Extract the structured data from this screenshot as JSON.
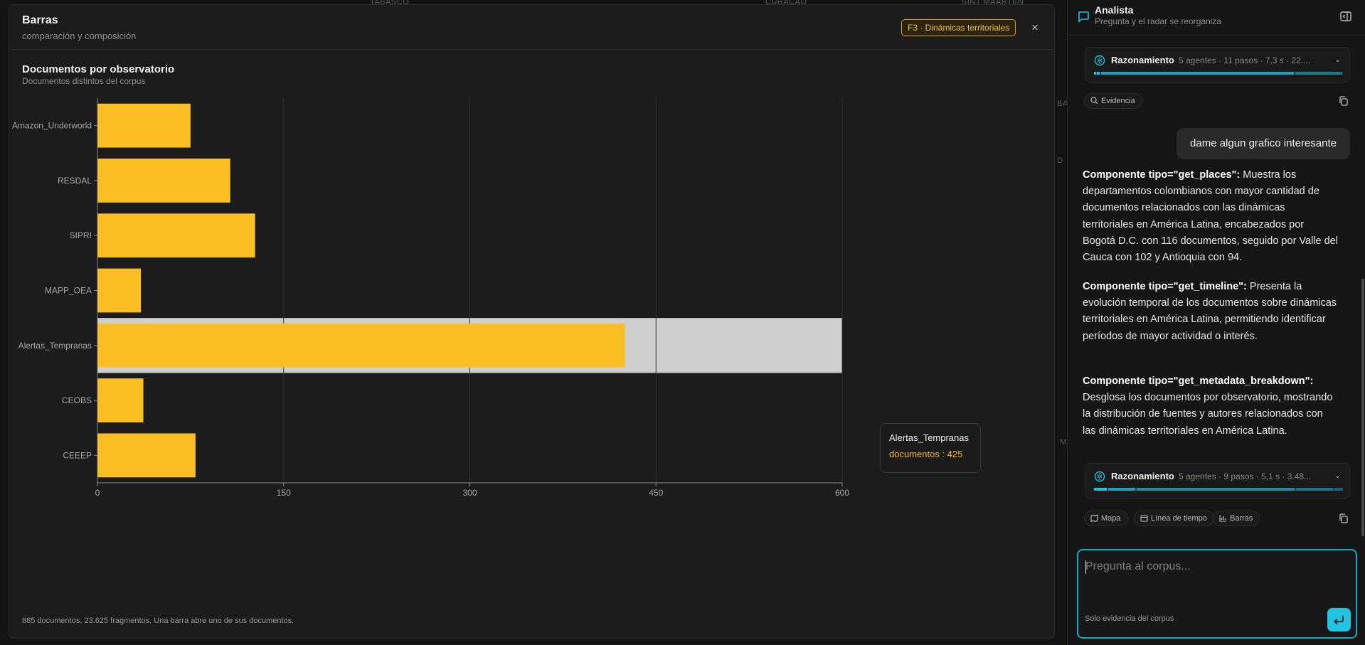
{
  "map": {
    "labels": [
      "TABASCO",
      "SINT MAARTEN",
      "CURAÇAO"
    ],
    "fragments": [
      "BA",
      "D",
      "M"
    ]
  },
  "modal": {
    "title": "Barras",
    "subtitle": "comparación y composición",
    "badge": "F3 · Dinámicas territoriales",
    "close_icon": "close-icon",
    "chart_title": "Documentos por observatorio",
    "chart_subtitle": "Documentos distintos del corpus",
    "footer": "885 documentos, 23.625 fragmentos. Una barra abre uno de sus documentos.",
    "tooltip": {
      "name": "Alertas_Tempranas",
      "value": "documentos : 425"
    }
  },
  "chart_data": {
    "type": "bar",
    "orientation": "horizontal",
    "categories": [
      "Amazon_Underworld",
      "RESDAL",
      "SIPRI",
      "MAPP_OEA",
      "Alertas_Tempranas",
      "CEOBS",
      "CEEEP"
    ],
    "series": [
      {
        "name": "documentos",
        "values": [
          75,
          107,
          127,
          35,
          425,
          37,
          79
        ]
      }
    ],
    "xlim": [
      0,
      600
    ],
    "xticks": [
      "0",
      "150",
      "300",
      "450",
      "600"
    ],
    "grid": true,
    "highlighted": "Alertas_Tempranas",
    "colors": {
      "bar": "#fbbf24",
      "highlight_band": "#cfcfcf",
      "grid": "#333333"
    }
  },
  "panel": {
    "title": "Analista",
    "subtitle": "Pregunta y el radar se reorganiza",
    "reasoning_1": {
      "label": "Razonamiento",
      "meta": "5 agentes · 11 pasos · 7,3 s · 22...."
    },
    "evidence_chip": "Evidencia",
    "user_message": "dame algun grafico interesante",
    "answer": [
      {
        "label": "Componente tipo=\"get_places\":",
        "text": " Muestra los departamentos colombianos con mayor cantidad de documentos relacionados con las dinámicas territoriales en América Latina, encabezados por Bogotá D.C. con 116 documentos, seguido por Valle del Cauca con 102 y Antioquia con 94."
      },
      {
        "label": "Componente tipo=\"get_timeline\":",
        "text": " Presenta la evolución temporal de los documentos sobre dinámicas territoriales en América Latina, permitiendo identificar períodos de mayor actividad o interés."
      },
      {
        "label": "Componente tipo=\"get_metadata_breakdown\":",
        "text": " Desglosa los documentos por observatorio, mostrando la distribución de fuentes y autores relacionados con las dinámicas territoriales en América Latina."
      }
    ],
    "reasoning_2": {
      "label": "Razonamiento",
      "meta": "5 agentes · 9 pasos · 5,1 s · 3.48..."
    },
    "chips": [
      "Mapa",
      "Línea de tiempo",
      "Barras"
    ],
    "input_placeholder": "Pregunta al corpus...",
    "input_note": "Solo evidencia del corpus",
    "accent": "#22c4e0"
  }
}
